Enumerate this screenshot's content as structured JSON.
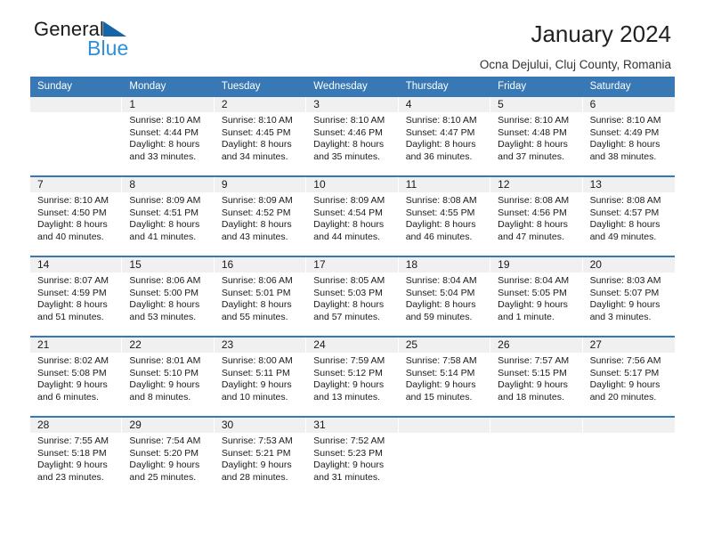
{
  "brand": {
    "line1": "General",
    "line2": "Blue",
    "triangle_icon": "triangle-icon",
    "triangle_color": "#1565a8",
    "line2_color": "#2f8fd8"
  },
  "header": {
    "title": "January 2024",
    "subtitle": "Ocna Dejului, Cluj County, Romania"
  },
  "calendar": {
    "header_bg": "#3778b5",
    "day_band_bg": "#f0f0f0",
    "weekdays": [
      "Sunday",
      "Monday",
      "Tuesday",
      "Wednesday",
      "Thursday",
      "Friday",
      "Saturday"
    ],
    "weeks": [
      [
        {
          "day": "",
          "sunrise": "",
          "sunset": "",
          "daylight": "",
          "empty": true
        },
        {
          "day": "1",
          "sunrise": "Sunrise: 8:10 AM",
          "sunset": "Sunset: 4:44 PM",
          "daylight": "Daylight: 8 hours and 33 minutes."
        },
        {
          "day": "2",
          "sunrise": "Sunrise: 8:10 AM",
          "sunset": "Sunset: 4:45 PM",
          "daylight": "Daylight: 8 hours and 34 minutes."
        },
        {
          "day": "3",
          "sunrise": "Sunrise: 8:10 AM",
          "sunset": "Sunset: 4:46 PM",
          "daylight": "Daylight: 8 hours and 35 minutes."
        },
        {
          "day": "4",
          "sunrise": "Sunrise: 8:10 AM",
          "sunset": "Sunset: 4:47 PM",
          "daylight": "Daylight: 8 hours and 36 minutes."
        },
        {
          "day": "5",
          "sunrise": "Sunrise: 8:10 AM",
          "sunset": "Sunset: 4:48 PM",
          "daylight": "Daylight: 8 hours and 37 minutes."
        },
        {
          "day": "6",
          "sunrise": "Sunrise: 8:10 AM",
          "sunset": "Sunset: 4:49 PM",
          "daylight": "Daylight: 8 hours and 38 minutes."
        }
      ],
      [
        {
          "day": "7",
          "sunrise": "Sunrise: 8:10 AM",
          "sunset": "Sunset: 4:50 PM",
          "daylight": "Daylight: 8 hours and 40 minutes."
        },
        {
          "day": "8",
          "sunrise": "Sunrise: 8:09 AM",
          "sunset": "Sunset: 4:51 PM",
          "daylight": "Daylight: 8 hours and 41 minutes."
        },
        {
          "day": "9",
          "sunrise": "Sunrise: 8:09 AM",
          "sunset": "Sunset: 4:52 PM",
          "daylight": "Daylight: 8 hours and 43 minutes."
        },
        {
          "day": "10",
          "sunrise": "Sunrise: 8:09 AM",
          "sunset": "Sunset: 4:54 PM",
          "daylight": "Daylight: 8 hours and 44 minutes."
        },
        {
          "day": "11",
          "sunrise": "Sunrise: 8:08 AM",
          "sunset": "Sunset: 4:55 PM",
          "daylight": "Daylight: 8 hours and 46 minutes."
        },
        {
          "day": "12",
          "sunrise": "Sunrise: 8:08 AM",
          "sunset": "Sunset: 4:56 PM",
          "daylight": "Daylight: 8 hours and 47 minutes."
        },
        {
          "day": "13",
          "sunrise": "Sunrise: 8:08 AM",
          "sunset": "Sunset: 4:57 PM",
          "daylight": "Daylight: 8 hours and 49 minutes."
        }
      ],
      [
        {
          "day": "14",
          "sunrise": "Sunrise: 8:07 AM",
          "sunset": "Sunset: 4:59 PM",
          "daylight": "Daylight: 8 hours and 51 minutes."
        },
        {
          "day": "15",
          "sunrise": "Sunrise: 8:06 AM",
          "sunset": "Sunset: 5:00 PM",
          "daylight": "Daylight: 8 hours and 53 minutes."
        },
        {
          "day": "16",
          "sunrise": "Sunrise: 8:06 AM",
          "sunset": "Sunset: 5:01 PM",
          "daylight": "Daylight: 8 hours and 55 minutes."
        },
        {
          "day": "17",
          "sunrise": "Sunrise: 8:05 AM",
          "sunset": "Sunset: 5:03 PM",
          "daylight": "Daylight: 8 hours and 57 minutes."
        },
        {
          "day": "18",
          "sunrise": "Sunrise: 8:04 AM",
          "sunset": "Sunset: 5:04 PM",
          "daylight": "Daylight: 8 hours and 59 minutes."
        },
        {
          "day": "19",
          "sunrise": "Sunrise: 8:04 AM",
          "sunset": "Sunset: 5:05 PM",
          "daylight": "Daylight: 9 hours and 1 minute."
        },
        {
          "day": "20",
          "sunrise": "Sunrise: 8:03 AM",
          "sunset": "Sunset: 5:07 PM",
          "daylight": "Daylight: 9 hours and 3 minutes."
        }
      ],
      [
        {
          "day": "21",
          "sunrise": "Sunrise: 8:02 AM",
          "sunset": "Sunset: 5:08 PM",
          "daylight": "Daylight: 9 hours and 6 minutes."
        },
        {
          "day": "22",
          "sunrise": "Sunrise: 8:01 AM",
          "sunset": "Sunset: 5:10 PM",
          "daylight": "Daylight: 9 hours and 8 minutes."
        },
        {
          "day": "23",
          "sunrise": "Sunrise: 8:00 AM",
          "sunset": "Sunset: 5:11 PM",
          "daylight": "Daylight: 9 hours and 10 minutes."
        },
        {
          "day": "24",
          "sunrise": "Sunrise: 7:59 AM",
          "sunset": "Sunset: 5:12 PM",
          "daylight": "Daylight: 9 hours and 13 minutes."
        },
        {
          "day": "25",
          "sunrise": "Sunrise: 7:58 AM",
          "sunset": "Sunset: 5:14 PM",
          "daylight": "Daylight: 9 hours and 15 minutes."
        },
        {
          "day": "26",
          "sunrise": "Sunrise: 7:57 AM",
          "sunset": "Sunset: 5:15 PM",
          "daylight": "Daylight: 9 hours and 18 minutes."
        },
        {
          "day": "27",
          "sunrise": "Sunrise: 7:56 AM",
          "sunset": "Sunset: 5:17 PM",
          "daylight": "Daylight: 9 hours and 20 minutes."
        }
      ],
      [
        {
          "day": "28",
          "sunrise": "Sunrise: 7:55 AM",
          "sunset": "Sunset: 5:18 PM",
          "daylight": "Daylight: 9 hours and 23 minutes."
        },
        {
          "day": "29",
          "sunrise": "Sunrise: 7:54 AM",
          "sunset": "Sunset: 5:20 PM",
          "daylight": "Daylight: 9 hours and 25 minutes."
        },
        {
          "day": "30",
          "sunrise": "Sunrise: 7:53 AM",
          "sunset": "Sunset: 5:21 PM",
          "daylight": "Daylight: 9 hours and 28 minutes."
        },
        {
          "day": "31",
          "sunrise": "Sunrise: 7:52 AM",
          "sunset": "Sunset: 5:23 PM",
          "daylight": "Daylight: 9 hours and 31 minutes."
        },
        {
          "day": "",
          "sunrise": "",
          "sunset": "",
          "daylight": "",
          "empty": true
        },
        {
          "day": "",
          "sunrise": "",
          "sunset": "",
          "daylight": "",
          "empty": true
        },
        {
          "day": "",
          "sunrise": "",
          "sunset": "",
          "daylight": "",
          "empty": true
        }
      ]
    ]
  }
}
